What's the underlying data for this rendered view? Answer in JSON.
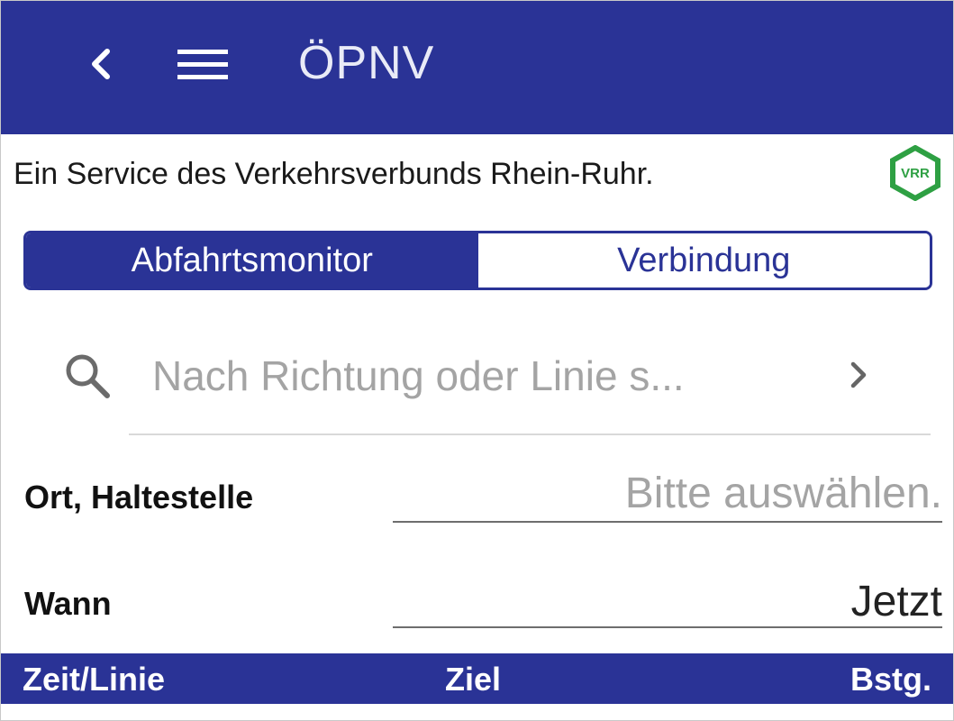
{
  "appbar": {
    "title": "ÖPNV",
    "back_icon": "chevron-left-icon",
    "menu_icon": "hamburger-menu-icon",
    "background": "#2a3396"
  },
  "service": {
    "text": "Ein Service des Verkehrsverbunds Rhein-Ruhr.",
    "logo_text": "VRR",
    "logo_color": "#2ea043"
  },
  "tabs": [
    {
      "label": "Abfahrtsmonitor",
      "active": true
    },
    {
      "label": "Verbindung",
      "active": false
    }
  ],
  "search": {
    "placeholder": "Nach Richtung oder Linie s...",
    "icon": "search-icon"
  },
  "form": {
    "location": {
      "label": "Ort, Haltestelle",
      "value": "Bitte auswählen."
    },
    "time": {
      "label": "Wann",
      "value": "Jetzt"
    }
  },
  "table": {
    "columns": [
      "Zeit/Linie",
      "Ziel",
      "Bstg."
    ]
  }
}
